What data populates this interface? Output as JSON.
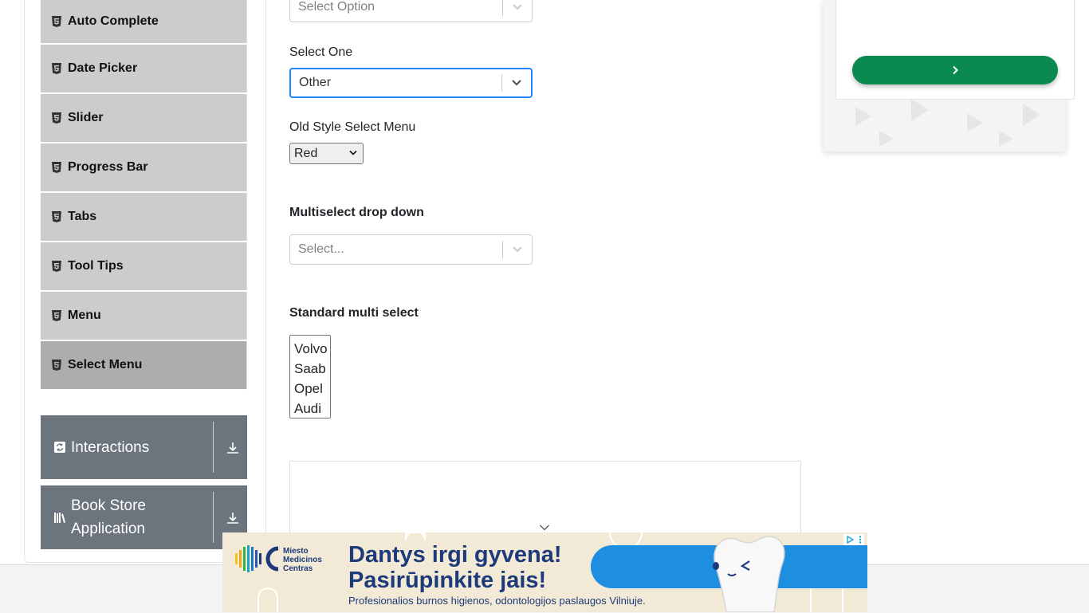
{
  "sidebar": {
    "items": [
      {
        "label": "Auto Complete"
      },
      {
        "label": "Date Picker"
      },
      {
        "label": "Slider"
      },
      {
        "label": "Progress Bar"
      },
      {
        "label": "Tabs"
      },
      {
        "label": "Tool Tips"
      },
      {
        "label": "Menu"
      },
      {
        "label": "Select Menu",
        "active": true
      }
    ],
    "groups": [
      {
        "label": "Interactions"
      },
      {
        "label": "Book Store Application"
      }
    ]
  },
  "form": {
    "select_option_placeholder": "Select Option",
    "select_one_label": "Select One",
    "select_one_value": "Other",
    "old_style_label": "Old Style Select Menu",
    "old_style_value": "Red",
    "multiselect_label": "Multiselect drop down",
    "multiselect_placeholder": "Select...",
    "standard_multi_label": "Standard multi select",
    "standard_multi_options": [
      "Volvo",
      "Saab",
      "Opel",
      "Audi"
    ]
  },
  "ad": {
    "logo_lines": [
      "Miesto",
      "Medicinos",
      "Centras"
    ],
    "headline_1": "Dantys irgi gyvena!",
    "headline_2": "Pasirūpinkite jais!",
    "subtext": "Profesionalios burnos higienos, odontologijos paslaugos Vilniuje."
  },
  "colors": {
    "sidebar_bg": "#cccccc",
    "sidebar_active_bg": "#adadad",
    "group_bg": "#6c757d",
    "focus_border": "#2684ff",
    "ad_button": "#0a8a4e",
    "ad_blue": "#1e8fe0",
    "ad_navy": "#1d3a7a"
  }
}
